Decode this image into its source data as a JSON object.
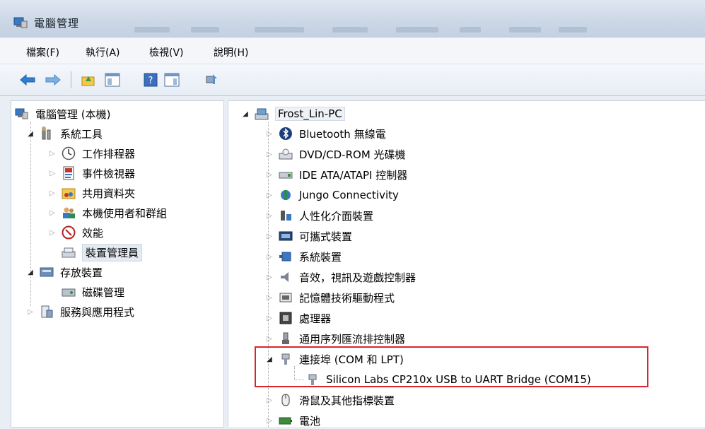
{
  "window": {
    "title": "電腦管理"
  },
  "menu": [
    "檔案(F)",
    "執行(A)",
    "檢視(V)",
    "說明(H)"
  ],
  "toolbar": {
    "icons": [
      "back-arrow-icon",
      "forward-arrow-icon",
      "up-folder-icon",
      "show-hide-tree-icon",
      "help-icon",
      "action-pane-icon",
      "scan-hardware-icon"
    ]
  },
  "left_tree": {
    "root": "電腦管理 (本機)",
    "system_tools": "系統工具",
    "task_scheduler": "工作排程器",
    "event_viewer": "事件檢視器",
    "shared_folders": "共用資料夾",
    "local_users": "本機使用者和群組",
    "performance": "效能",
    "device_manager": "裝置管理員",
    "storage": "存放裝置",
    "disk_management": "磁碟管理",
    "services_apps": "服務與應用程式"
  },
  "right_tree": {
    "computer": "Frost_Lin-PC",
    "items": [
      "Bluetooth 無線電",
      "DVD/CD-ROM 光碟機",
      "IDE ATA/ATAPI 控制器",
      "Jungo Connectivity",
      "人性化介面裝置",
      "可攜式裝置",
      "系統裝置",
      "音效，視訊及遊戲控制器",
      "記憶體技術驅動程式",
      "處理器",
      "通用序列匯流排控制器"
    ],
    "ports": "連接埠 (COM 和 LPT)",
    "ports_child": "Silicon Labs CP210x USB to UART Bridge (COM15)",
    "after": [
      "滑鼠及其他指標裝置",
      "電池"
    ]
  }
}
